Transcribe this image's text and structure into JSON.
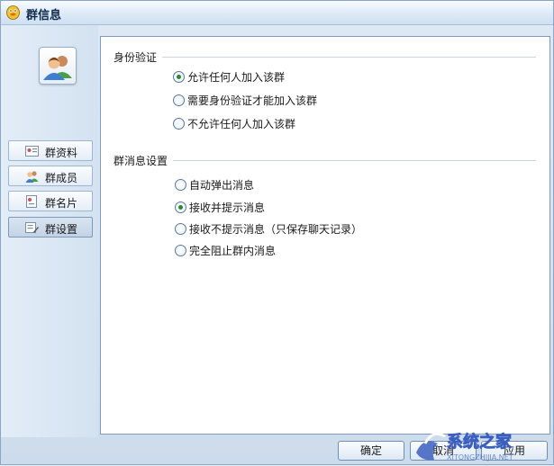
{
  "window": {
    "title": "群信息"
  },
  "sidebar": {
    "items": [
      {
        "label": "群资料",
        "icon": "profile-card-icon"
      },
      {
        "label": "群成员",
        "icon": "members-icon"
      },
      {
        "label": "群名片",
        "icon": "name-card-icon"
      },
      {
        "label": "群设置",
        "icon": "settings-icon"
      }
    ],
    "active_index": 3
  },
  "identity": {
    "title": "身份验证",
    "options": [
      "允许任何人加入该群",
      "需要身份验证才能加入该群",
      "不允许任何人加入该群"
    ],
    "selected_index": 0
  },
  "messages": {
    "title": "群消息设置",
    "options": [
      "自动弹出消息",
      "接收并提示消息",
      "接收不提示消息（只保存聊天记录）",
      "完全阻止群内消息"
    ],
    "selected_index": 1
  },
  "buttons": {
    "ok": "确定",
    "cancel": "取消",
    "apply": "应用"
  },
  "watermark": {
    "text": "系统之家",
    "subtext": "XITONGZHIJIA.NET"
  }
}
